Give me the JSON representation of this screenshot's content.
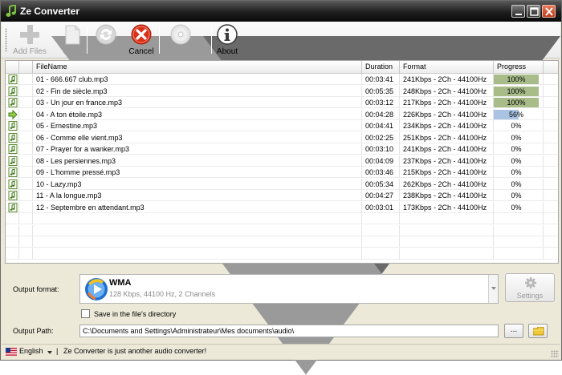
{
  "window": {
    "title": "Ze Converter"
  },
  "toolbar": {
    "add_files": "Add Files",
    "clear": "Clear",
    "convert": "Convert",
    "cancel": "Cancel",
    "cd_ripper": "CD Ripper",
    "about": "About"
  },
  "grid": {
    "columns": [
      "FileName",
      "Duration",
      "Format",
      "Progress"
    ],
    "rows": [
      {
        "icon": "music-file-icon",
        "filename": "01 - 666.667 club.mp3",
        "duration": "00:03:41",
        "format": "241Kbps - 2Ch - 44100Hz",
        "progress": 100,
        "progress_label": "100%"
      },
      {
        "icon": "music-file-icon",
        "filename": "02 - Fin de siècle.mp3",
        "duration": "00:05:35",
        "format": "248Kbps - 2Ch - 44100Hz",
        "progress": 100,
        "progress_label": "100%"
      },
      {
        "icon": "music-file-icon",
        "filename": "03 - Un jour en france.mp3",
        "duration": "00:03:12",
        "format": "217Kbps - 2Ch - 44100Hz",
        "progress": 100,
        "progress_label": "100%"
      },
      {
        "icon": "arrow-right-icon",
        "filename": "04 - A ton étoile.mp3",
        "duration": "00:04:28",
        "format": "226Kbps - 2Ch - 44100Hz",
        "progress": 56,
        "progress_label": "56%"
      },
      {
        "icon": "music-file-icon",
        "filename": "05 - Ernestine.mp3",
        "duration": "00:04:41",
        "format": "234Kbps - 2Ch - 44100Hz",
        "progress": 0,
        "progress_label": "0%"
      },
      {
        "icon": "music-file-icon",
        "filename": "06 - Comme elle vient.mp3",
        "duration": "00:02:25",
        "format": "251Kbps - 2Ch - 44100Hz",
        "progress": 0,
        "progress_label": "0%"
      },
      {
        "icon": "music-file-icon",
        "filename": "07 - Prayer for a wanker.mp3",
        "duration": "00:03:10",
        "format": "241Kbps - 2Ch - 44100Hz",
        "progress": 0,
        "progress_label": "0%"
      },
      {
        "icon": "music-file-icon",
        "filename": "08 - Les persiennes.mp3",
        "duration": "00:04:09",
        "format": "237Kbps - 2Ch - 44100Hz",
        "progress": 0,
        "progress_label": "0%"
      },
      {
        "icon": "music-file-icon",
        "filename": "09 - L'homme pressé.mp3",
        "duration": "00:03:46",
        "format": "215Kbps - 2Ch - 44100Hz",
        "progress": 0,
        "progress_label": "0%"
      },
      {
        "icon": "music-file-icon",
        "filename": "10 - Lazy.mp3",
        "duration": "00:05:34",
        "format": "262Kbps - 2Ch - 44100Hz",
        "progress": 0,
        "progress_label": "0%"
      },
      {
        "icon": "music-file-icon",
        "filename": "11 - A la longue.mp3",
        "duration": "00:04:27",
        "format": "238Kbps - 2Ch - 44100Hz",
        "progress": 0,
        "progress_label": "0%"
      },
      {
        "icon": "music-file-icon",
        "filename": "12 - Septembre en attendant.mp3",
        "duration": "00:03:01",
        "format": "173Kbps - 2Ch - 44100Hz",
        "progress": 0,
        "progress_label": "0%"
      }
    ]
  },
  "output": {
    "format_label": "Output format:",
    "format_name": "WMA",
    "format_desc": "128 Kbps, 44100 Hz, 2 Channels",
    "settings": "Settings",
    "save_in_dir": "Save in the file's directory",
    "path_label": "Output Path:",
    "path_value": "C:\\Documents and Settings\\Administrateur\\Mes documents\\audio\\",
    "browse": "..."
  },
  "status": {
    "language": "English",
    "separator": "|",
    "message": "Ze Converter is just another audio converter!"
  },
  "colors": {
    "progress_done": "#a8bc8a",
    "progress_active": "#a9c4e2",
    "cancel_red": "#d9301a"
  }
}
